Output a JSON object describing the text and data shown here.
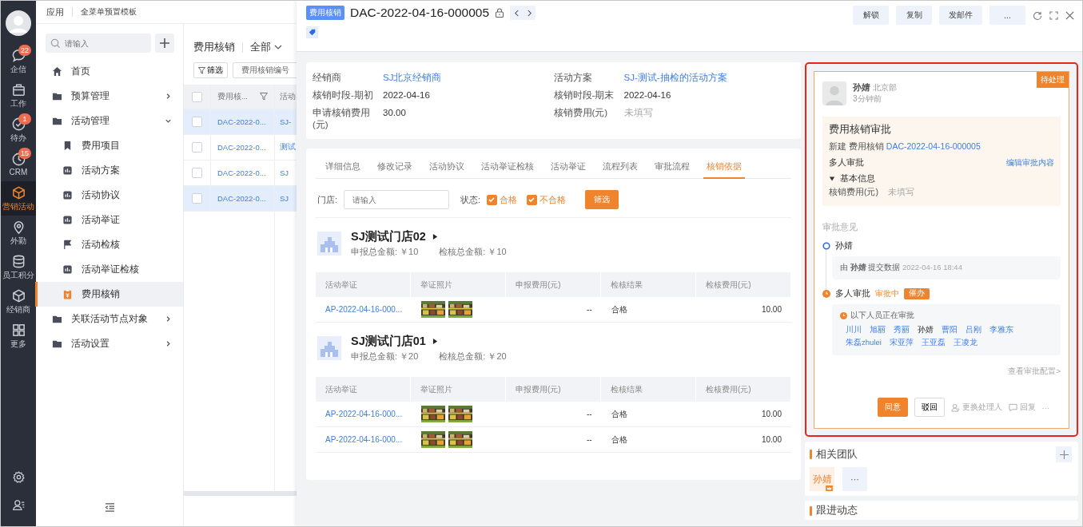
{
  "nav_rail": {
    "items": [
      {
        "kind": "chat",
        "label": "企信",
        "badge": "22",
        "selected": false
      },
      {
        "kind": "briefcase",
        "label": "工作",
        "selected": false
      },
      {
        "kind": "check",
        "label": "待办",
        "badge": "1",
        "selected": false
      },
      {
        "kind": "clock",
        "label": "CRM",
        "badge": "15",
        "selected": false
      },
      {
        "kind": "cube",
        "label": "营销活动",
        "selected": true
      },
      {
        "kind": "pin",
        "label": "外勤",
        "selected": false
      },
      {
        "kind": "database",
        "label": "员工积分",
        "selected": false
      },
      {
        "kind": "box",
        "label": "经销商",
        "selected": false
      },
      {
        "kind": "grid",
        "label": "更多",
        "selected": false
      }
    ]
  },
  "breadcrumb": {
    "app": "应用",
    "template": "全菜单预置模板"
  },
  "sidebar": {
    "search": {
      "placeholder": "请输入"
    },
    "items": [
      {
        "kind": "home",
        "label": "首页",
        "selected": false
      },
      {
        "kind": "folder",
        "label": "预算管理",
        "expanded": false,
        "selected": false
      },
      {
        "kind": "folder",
        "label": "活动管理",
        "expanded": true,
        "selected": false,
        "children": [
          {
            "kind": "bookmark",
            "label": "费用项目",
            "selected": false
          },
          {
            "kind": "doc",
            "label": "活动方案",
            "selected": false
          },
          {
            "kind": "doc",
            "label": "活动协议",
            "selected": false
          },
          {
            "kind": "doc",
            "label": "活动举证",
            "selected": false
          },
          {
            "kind": "flag",
            "label": "活动检核",
            "selected": false
          },
          {
            "kind": "doc",
            "label": "活动举证检核",
            "selected": false
          },
          {
            "kind": "clipboard",
            "label": "费用核销",
            "selected": true
          }
        ]
      },
      {
        "kind": "folder",
        "label": "关联活动节点对象",
        "expanded": false,
        "selected": false
      },
      {
        "kind": "folder",
        "label": "活动设置",
        "expanded": false,
        "selected": false
      }
    ]
  },
  "list": {
    "title": "费用核销",
    "scope": "全部",
    "filter_button": "筛选",
    "field_select": "费用核销编号",
    "all_checked": false,
    "columns": [
      "费用核...",
      "活动"
    ],
    "rows": [
      {
        "id": "DAC-2022-0...",
        "plan": "SJ-",
        "checked": false,
        "selected": true
      },
      {
        "id": "DAC-2022-0...",
        "plan": "测试",
        "checked": false,
        "selected": false
      },
      {
        "id": "DAC-2022-0...",
        "plan": "SJ",
        "checked": false,
        "selected": false
      },
      {
        "id": "DAC-2022-0...",
        "plan": "SJ",
        "checked": false,
        "selected": true
      }
    ]
  },
  "detail": {
    "tag": "费用核销",
    "title": "DAC-2022-04-16-000005",
    "actions": [
      "解锁",
      "复制",
      "发邮件",
      "..."
    ],
    "fields": [
      {
        "label": "经销商",
        "value": "SJ北京经销商",
        "kind": "link"
      },
      {
        "label": "活动方案",
        "value": "SJ-测试-抽检的活动方案",
        "kind": "link"
      },
      {
        "label": "核销时段-期初",
        "value": "2022-04-16",
        "kind": "text"
      },
      {
        "label": "核销时段-期末",
        "value": "2022-04-16",
        "kind": "text"
      },
      {
        "label": "申请核销费用(元)",
        "value": "30.00",
        "kind": "text"
      },
      {
        "label": "核销费用(元)",
        "value": "未填写",
        "kind": "empty"
      }
    ],
    "tabs": [
      {
        "label": "详细信息",
        "selected": false
      },
      {
        "label": "修改记录",
        "selected": false
      },
      {
        "label": "活动协议",
        "selected": false
      },
      {
        "label": "活动举证检核",
        "selected": false
      },
      {
        "label": "活动举证",
        "selected": false
      },
      {
        "label": "流程列表",
        "selected": false
      },
      {
        "label": "审批流程",
        "selected": false
      },
      {
        "label": "核销依据",
        "selected": true
      }
    ],
    "filter": {
      "store_label": "门店:",
      "store_placeholder": "请输入",
      "status_label": "状态:",
      "options": [
        {
          "label": "合格",
          "checked": true
        },
        {
          "label": "不合格",
          "checked": true
        }
      ],
      "button": "筛选"
    },
    "stores": [
      {
        "name": "SJ测试门店02",
        "declared": "申报总金额: ￥10",
        "checked_total": "检核总金额: ￥10",
        "columns": [
          "活动举证",
          "举证照片",
          "申报费用(元)",
          "检核结果",
          "检核费用(元)"
        ],
        "rows": [
          {
            "proof": "AP-2022-04-16-000...",
            "declared_fee": "--",
            "result": "合格",
            "checked_fee": "10.00"
          }
        ]
      },
      {
        "name": "SJ测试门店01",
        "declared": "申报总金额: ￥20",
        "checked_total": "检核总金额: ￥20",
        "columns": [
          "活动举证",
          "举证照片",
          "申报费用(元)",
          "检核结果",
          "检核费用(元)"
        ],
        "rows": [
          {
            "proof": "AP-2022-04-16-000...",
            "declared_fee": "--",
            "result": "合格",
            "checked_fee": "10.00"
          },
          {
            "proof": "AP-2022-04-16-000...",
            "declared_fee": "--",
            "result": "合格",
            "checked_fee": "10.00"
          }
        ]
      }
    ]
  },
  "approval": {
    "status": "待处理",
    "user": "孙婧",
    "dept": "北京部",
    "time": "3分钟前",
    "title": "费用核销审批",
    "summary_prefix": "新建 费用核销",
    "summary_link": "DAC-2022-04-16-000005",
    "mode": "多人审批",
    "edit_link": "编辑审批内容",
    "section": {
      "label": "基本信息",
      "expanded": true
    },
    "field": {
      "label": "核销费用(元)",
      "value": "未填写"
    },
    "opinions_label": "审批意见",
    "steps": [
      {
        "kind": "done",
        "name": "孙婧",
        "note": "由 **孙婧** 提交数据",
        "note_time": "2022-04-16 18:44"
      },
      {
        "kind": "pending",
        "name": "多人审批",
        "status": "审批中",
        "urge": "催办",
        "waiting_label": "以下人员正在审批",
        "approvers": [
          {
            "name": "川川",
            "current": false
          },
          {
            "name": "旭丽",
            "current": false
          },
          {
            "name": "秀丽",
            "current": false
          },
          {
            "name": "孙婧",
            "current": true
          },
          {
            "name": "曹阳",
            "current": false
          },
          {
            "name": "吕刚",
            "current": false
          },
          {
            "name": "李雅东",
            "current": false
          },
          {
            "name": "朱磊zhulei",
            "current": false
          },
          {
            "name": "宋亚萍",
            "current": false
          },
          {
            "name": "王亚磊",
            "current": false
          },
          {
            "name": "王凌龙",
            "current": false
          }
        ]
      }
    ],
    "config_link": "查看审批配置>",
    "buttons": {
      "agree": "同意",
      "reject": "驳回",
      "transfer": "更换处理人",
      "reply": "回复",
      "more": "···"
    }
  },
  "team": {
    "title": "相关团队",
    "members": [
      {
        "name": "孙婧",
        "owner": true
      }
    ],
    "more": "···"
  },
  "follow": {
    "title": "跟进动态"
  }
}
